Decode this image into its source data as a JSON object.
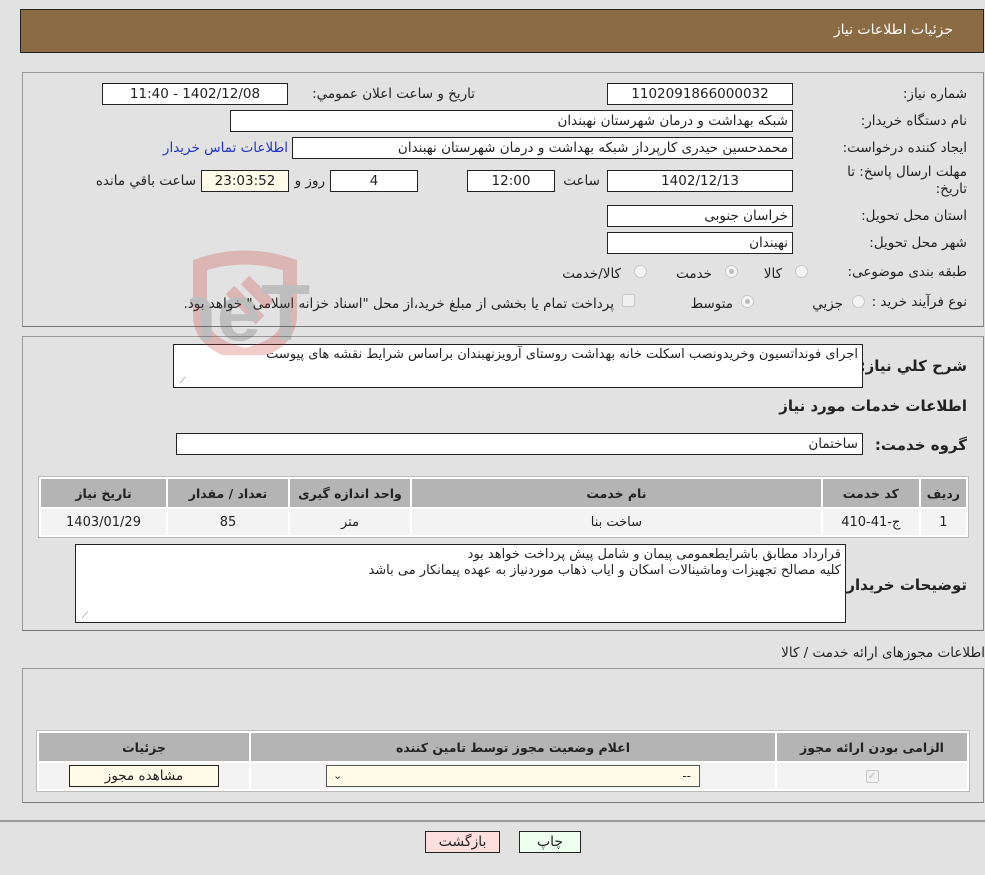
{
  "header": {
    "title": "جزئیات اطلاعات نیاز"
  },
  "details": {
    "need_number_label": "شماره نیاز:",
    "need_number": "1102091866000032",
    "announce_label": "تاریخ و ساعت اعلان عمومي:",
    "announce_value": "1402/12/08 - 11:40",
    "buyer_org_label": "نام دستگاه خریدار:",
    "buyer_org": "شبکه بهداشت و درمان شهرستان نهبندان",
    "creator_label": "ایجاد کننده درخواست:",
    "creator": "محمدحسین حیدری کارپرداز شبکه بهداشت و درمان شهرستان نهبندان",
    "contact_link": "اطلاعات تماس خریدار",
    "deadline_label": "مهلت ارسال پاسخ: تا تاریخ:",
    "deadline_date": "1402/12/13",
    "time_label": "ساعت",
    "deadline_time": "12:00",
    "days_value": "4",
    "days_label": "روز و",
    "remaining_time": "23:03:52",
    "remaining_label": "ساعت باقي مانده",
    "province_label": "استان محل تحویل:",
    "province": "خراسان جنوبی",
    "city_label": "شهر محل تحویل:",
    "city": "نهبندان",
    "category_label": "طبقه بندی موضوعی:",
    "category_options": [
      {
        "label": "کالا",
        "checked": false
      },
      {
        "label": "خدمت",
        "checked": true
      },
      {
        "label": "کالا/خدمت",
        "checked": false
      }
    ],
    "process_label": "نوع فرآیند خرید :",
    "process_options": [
      {
        "label": "جزيي",
        "checked": false
      },
      {
        "label": "متوسط",
        "checked": true
      }
    ],
    "treasury_note": "پرداخت تمام یا بخشی از مبلغ خرید،از محل \"اسناد خزانه اسلامی\" خواهد بود.",
    "treasury_checked": false
  },
  "description": {
    "label": "شرح کلي نیاز:",
    "text": "اجرای فونداتسیون وخریدونصب اسکلت خانه بهداشت روستای آرویزنهبندان براساس شرایط نقشه های پیوست"
  },
  "services": {
    "section_title": "اطلاعات خدمات مورد نیاز",
    "group_label": "گروه خدمت:",
    "group_value": "ساختمان",
    "columns": [
      "ردیف",
      "کد خدمت",
      "نام خدمت",
      "واحد اندازه گیری",
      "تعداد / مقدار",
      "تاریخ نیاز"
    ],
    "rows": [
      {
        "index": "1",
        "code": "ج-41-410",
        "name": "ساخت بنا",
        "unit": "متر",
        "qty": "85",
        "date": "1403/01/29"
      }
    ]
  },
  "buyer_notes": {
    "label": "توضیحات خریدار:",
    "line1": "قرارداد مطابق باشرایطعمومی پیمان و شامل پیش پرداخت خواهد بود",
    "line2": "کلیه مصالح تجهیزات وماشینالات اسکان و ایاب ذهاب موردنیاز به عهده پیمانکار می باشد"
  },
  "permits": {
    "section_title": "اطلاعات مجوزهای ارائه خدمت / کالا",
    "columns": [
      "الزامی بودن ارائه مجوز",
      "اعلام وضعیت مجوز توسط تامین کننده",
      "جزئیات"
    ],
    "rows": [
      {
        "required": true,
        "status_selected": "--",
        "details_button": "مشاهده مجوز"
      }
    ]
  },
  "footer": {
    "print_label": "چاپ",
    "back_label": "بازگشت"
  },
  "watermark": {
    "text": "AriaTender.neT"
  },
  "colors": {
    "header_bg": "#8b6b43",
    "page_bg": "#e2e2e2",
    "link": "#2233cc",
    "print_bg": "#efffef",
    "back_bg": "#ffdede",
    "cream": "#fffbe8"
  }
}
